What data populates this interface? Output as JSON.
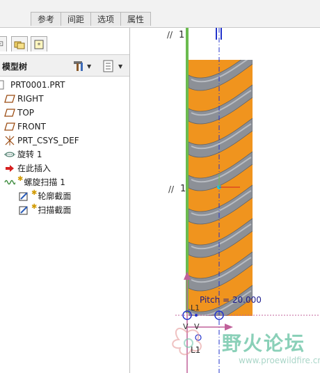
{
  "toolbar": {
    "tabs": [
      "参考",
      "间距",
      "选项",
      "属性"
    ]
  },
  "model_tree": {
    "title": "模型树",
    "items": [
      {
        "label": "PRT0001.PRT",
        "icon": "part-icon"
      },
      {
        "label": "RIGHT",
        "icon": "datum-plane-icon"
      },
      {
        "label": "TOP",
        "icon": "datum-plane-icon"
      },
      {
        "label": "FRONT",
        "icon": "datum-plane-icon"
      },
      {
        "label": "PRT_CSYS_DEF",
        "icon": "csys-icon"
      },
      {
        "label": "旋转 1",
        "icon": "revolve-icon"
      },
      {
        "label": "在此插入",
        "icon": "insert-here-arrow-icon"
      },
      {
        "label": "螺旋扫描 1",
        "icon": "helical-sweep-icon"
      },
      {
        "label": "轮廓截面",
        "icon": "sketch-icon"
      },
      {
        "label": "扫描截面",
        "icon": "sketch-icon"
      }
    ]
  },
  "graphics": {
    "datum_labels": [
      "1",
      "1",
      "L1",
      "L1"
    ],
    "pitch_text": "Pitch = 20.000"
  },
  "watermark": {
    "title": "野火论坛",
    "url": "www.proewildfire.cn"
  },
  "colors": {
    "helix_orange": "#f0941e",
    "helix_gray": "#8c9097",
    "axis_green": "#6bbb4f",
    "axis_blue": "#2233cc",
    "dim_pink": "#c0609a"
  }
}
